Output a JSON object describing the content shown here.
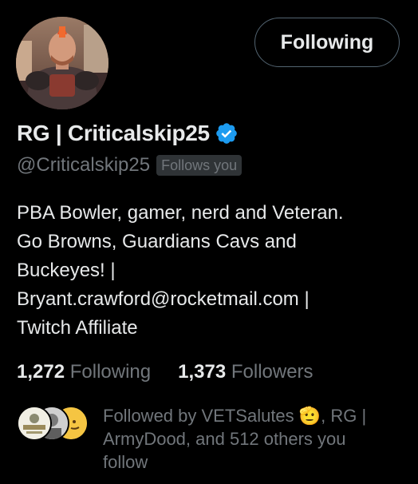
{
  "profile": {
    "display_name": "RG | Criticalskip25",
    "handle": "@Criticalskip25",
    "follows_you_badge": "Follows you",
    "verified": true
  },
  "actions": {
    "follow_button_label": "Following"
  },
  "bio": {
    "lines": [
      "PBA Bowler, gamer, nerd and Veteran.",
      "Go Browns, Guardians Cavs and",
      "Buckeyes! |",
      "Bryant.crawford@rocketmail.com |",
      "Twitch Affiliate"
    ]
  },
  "stats": {
    "following_count": "1,272",
    "following_label": "Following",
    "followers_count": "1,373",
    "followers_label": "Followers"
  },
  "followed_by": {
    "line1": "Followed by VETSalutes 🫡, RG |",
    "line2": "ArmyDood, and 512 others you",
    "line3": "follow"
  },
  "colors": {
    "background": "#000000",
    "primary_text": "#e7e9ea",
    "secondary_text": "#71767b",
    "verified_blue": "#1d9bf0",
    "button_border": "#536471"
  }
}
